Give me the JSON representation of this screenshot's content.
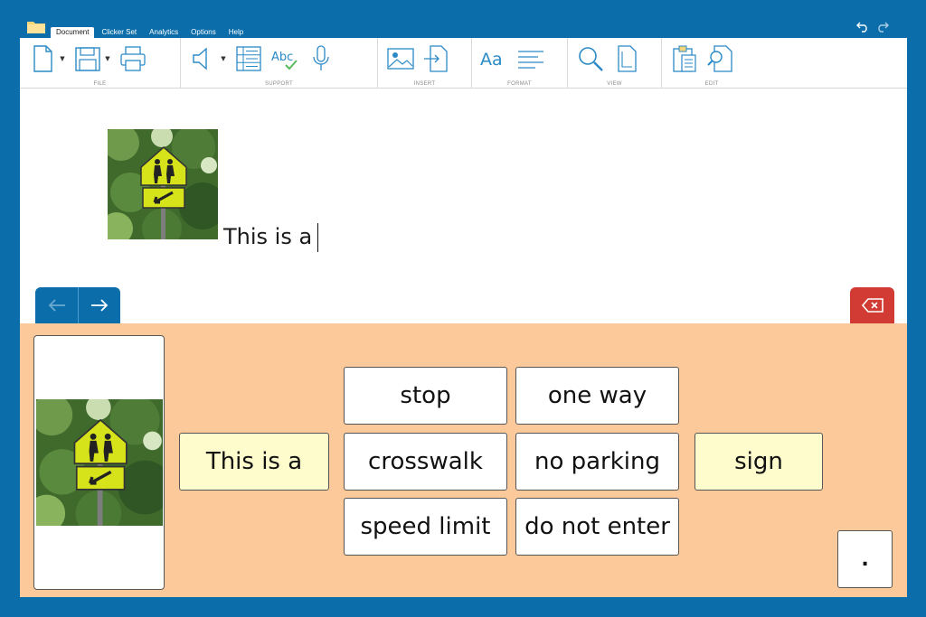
{
  "menu": {
    "tabs": [
      {
        "label": "Document"
      },
      {
        "label": "Clicker Set"
      },
      {
        "label": "Analytics"
      },
      {
        "label": "Options"
      },
      {
        "label": "Help"
      }
    ]
  },
  "ribbon": {
    "groups": [
      {
        "label": "FILE"
      },
      {
        "label": "SUPPORT"
      },
      {
        "label": "INSERT"
      },
      {
        "label": "FORMAT"
      },
      {
        "label": "VIEW"
      },
      {
        "label": "EDIT"
      }
    ],
    "format_icon_text": "Aa",
    "spell_icon_text": "Abc"
  },
  "document": {
    "text": "This is a"
  },
  "panel": {
    "sentence_start": "This is a",
    "words": [
      "stop",
      "one way",
      "crosswalk",
      "no parking",
      "speed limit",
      "do not enter"
    ],
    "end_word": "sign",
    "punctuation": "."
  },
  "colors": {
    "frame_blue": "#0b6eaa",
    "panel_orange": "#fcc99a",
    "cell_yellow": "#fefccc",
    "delete_red": "#d13b34"
  }
}
